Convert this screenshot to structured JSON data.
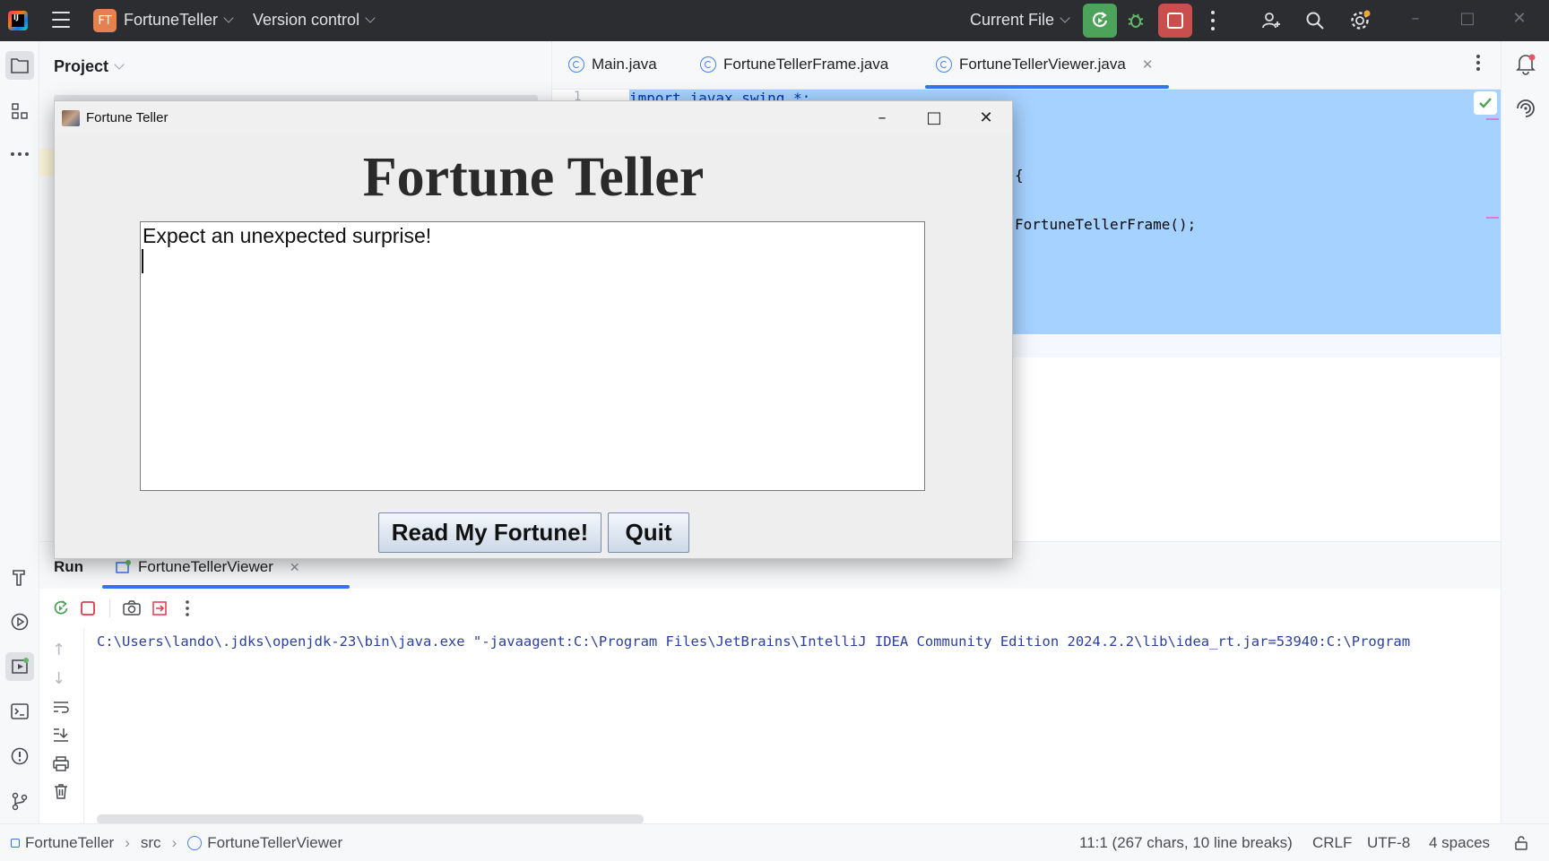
{
  "ide": {
    "title_bar": {
      "project_badge": "FT",
      "project_name": "FortuneTeller",
      "vcs_menu": "Version control",
      "run_config": "Current File"
    },
    "project_panel": {
      "title": "Project"
    },
    "editor": {
      "tabs": [
        {
          "label": "Main.java",
          "active": false
        },
        {
          "label": "FortuneTellerFrame.java",
          "active": false
        },
        {
          "label": "FortuneTellerViewer.java",
          "active": true
        }
      ],
      "line_number": "1",
      "code_lines": {
        "line1": "import javax.swing.*;",
        "brace": "{",
        "frame_call": "FortuneTellerFrame();"
      }
    },
    "run_panel": {
      "label": "Run",
      "tab_label": "FortuneTellerViewer",
      "console_line": "C:\\Users\\lando\\.jdks\\openjdk-23\\bin\\java.exe \"-javaagent:C:\\Program Files\\JetBrains\\IntelliJ IDEA Community Edition 2024.2.2\\lib\\idea_rt.jar=53940:C:\\Program"
    },
    "status_bar": {
      "breadcrumb": [
        "FortuneTeller",
        "src",
        "FortuneTellerViewer"
      ],
      "position": "11:1 (267 chars, 10 line breaks)",
      "line_separator": "CRLF",
      "encoding": "UTF-8",
      "indent": "4 spaces"
    },
    "colors": {
      "accent": "#3574f0",
      "run_green": "#4ea35a",
      "stop_red": "#c94f4f",
      "selection": "#a6d2ff",
      "project_badge": "#e5804f"
    }
  },
  "app_window": {
    "title": "Fortune Teller",
    "heading": "Fortune Teller",
    "fortune_text": "Expect an unexpected surprise!",
    "buttons": {
      "read": "Read My Fortune!",
      "quit": "Quit"
    }
  }
}
